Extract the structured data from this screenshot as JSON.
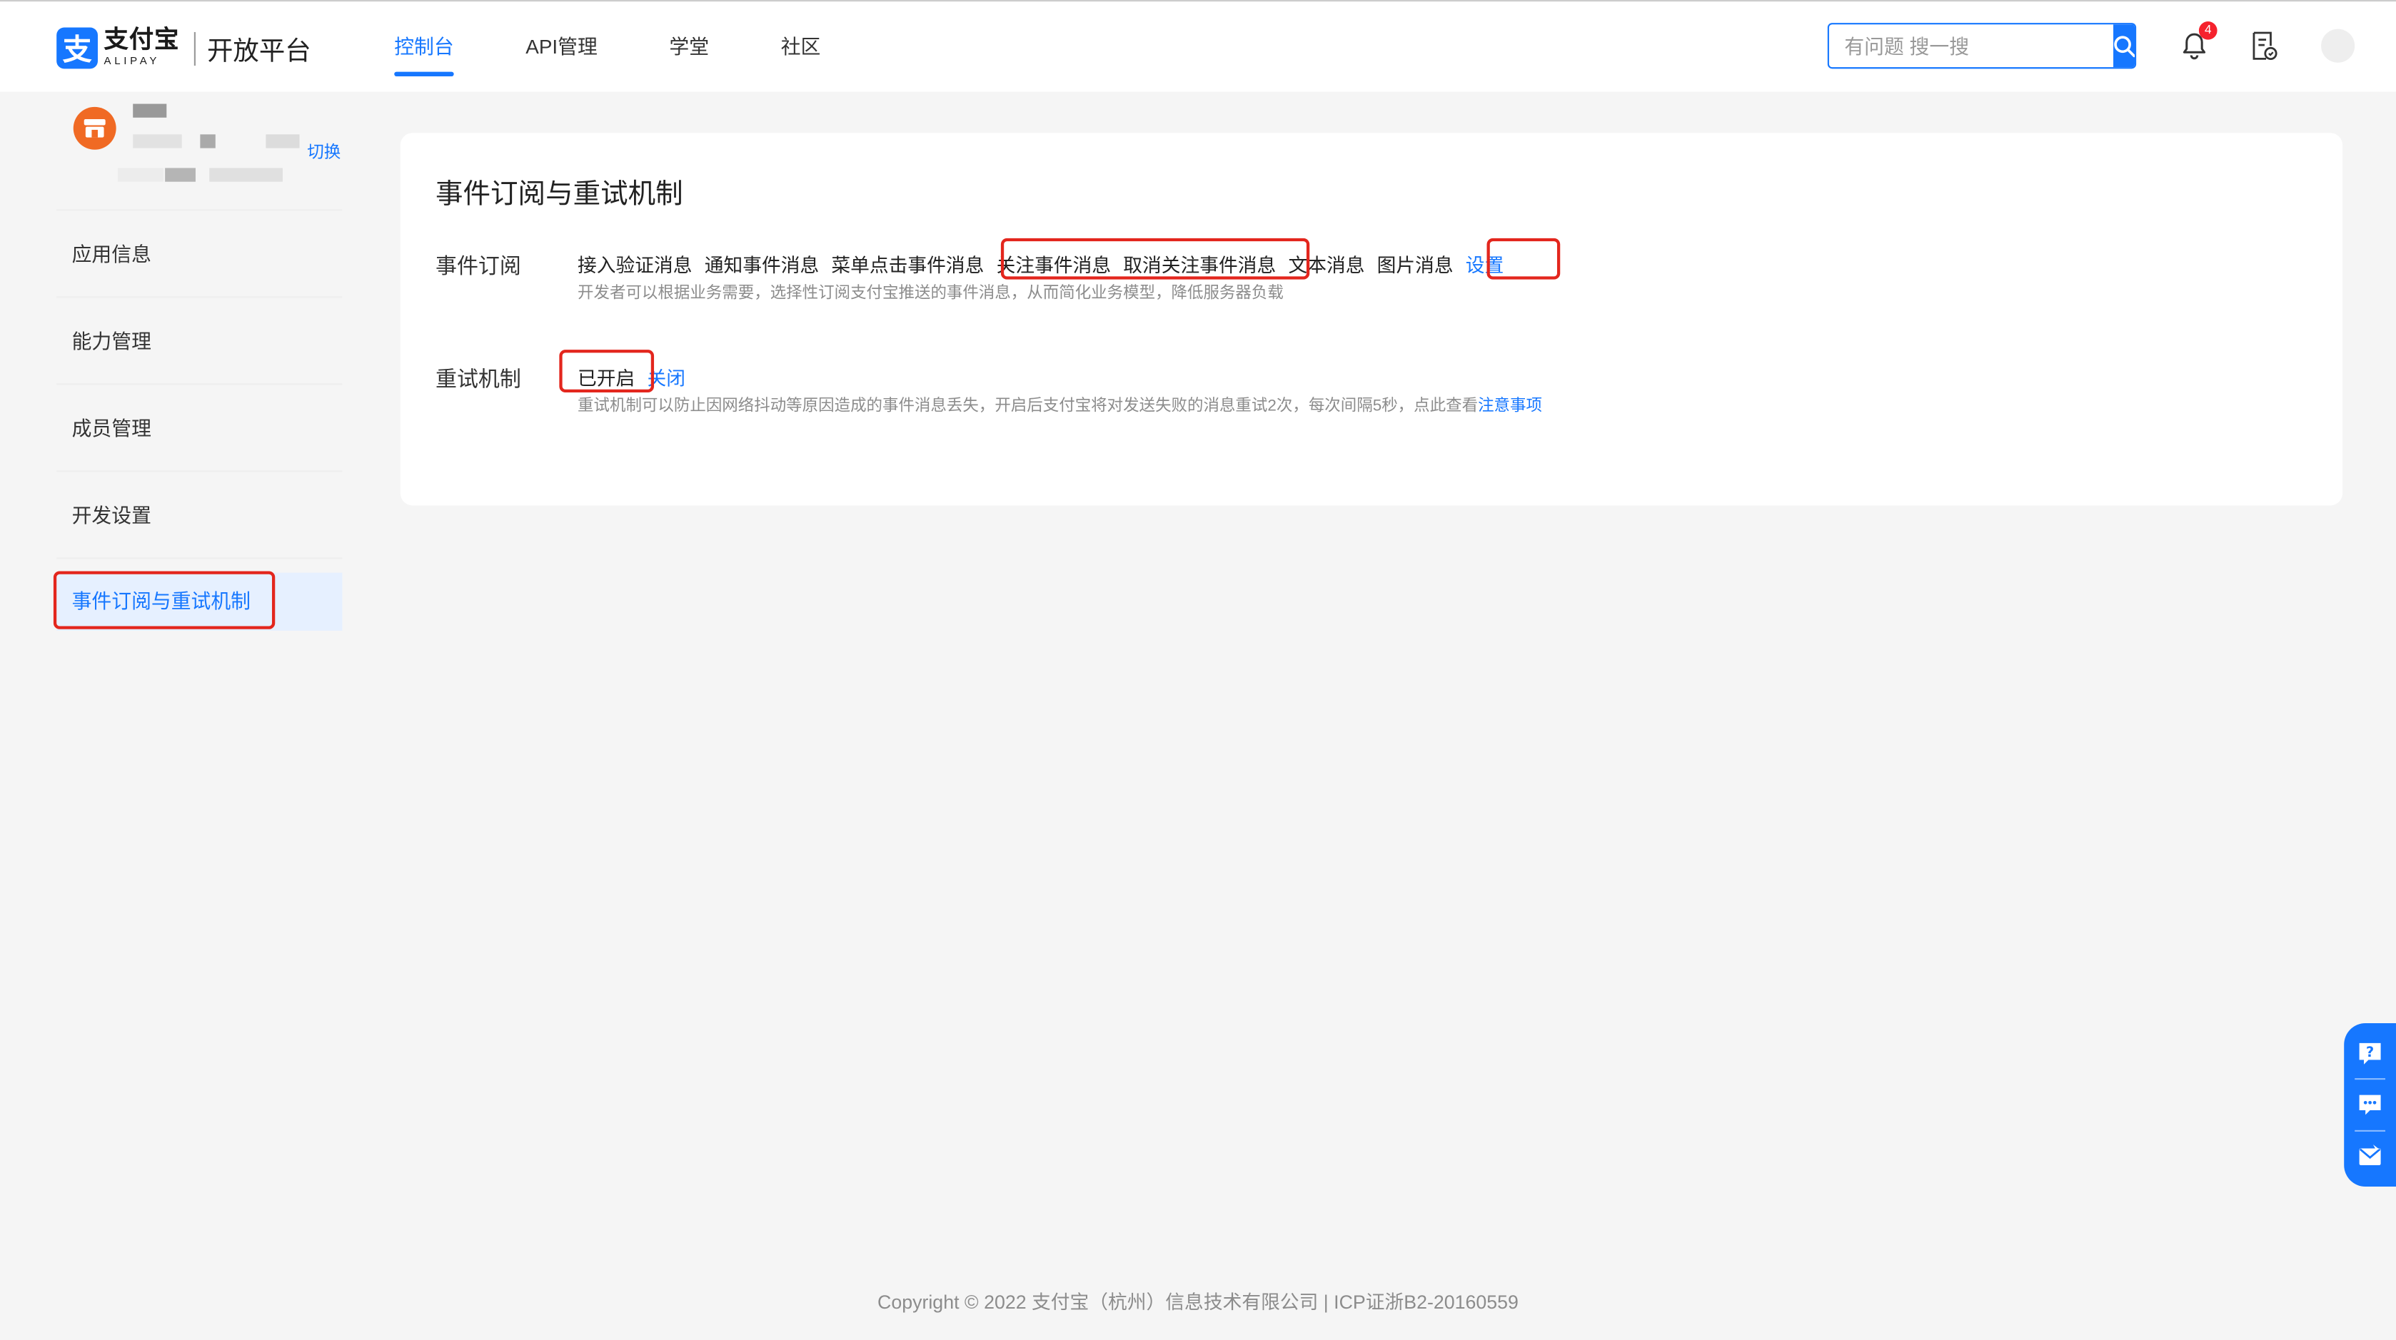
{
  "header": {
    "logo_cn": "支付宝",
    "logo_en": "ALIPAY",
    "logo_glyph": "支",
    "platform": "开放平台",
    "nav": [
      {
        "label": "控制台",
        "active": true
      },
      {
        "label": "API管理",
        "active": false
      },
      {
        "label": "学堂",
        "active": false
      },
      {
        "label": "社区",
        "active": false
      }
    ],
    "search_placeholder": "有问题 搜一搜",
    "notification_count": "4",
    "icons": {
      "search": "search-icon",
      "bell": "bell-icon",
      "document": "document-icon",
      "avatar": "avatar"
    },
    "accent_color": "#1677ff"
  },
  "sidebar": {
    "switch_label": "切换",
    "menu": [
      {
        "label": "应用信息",
        "active": false
      },
      {
        "label": "能力管理",
        "active": false
      },
      {
        "label": "成员管理",
        "active": false
      },
      {
        "label": "开发设置",
        "active": false
      },
      {
        "label": "事件订阅与重试机制",
        "active": true
      }
    ]
  },
  "main": {
    "title": "事件订阅与重试机制",
    "subscription": {
      "label": "事件订阅",
      "events": [
        "接入验证消息",
        "通知事件消息",
        "菜单点击事件消息",
        "关注事件消息",
        "取消关注事件消息",
        "文本消息",
        "图片消息"
      ],
      "settings_link": "设置",
      "hint": "开发者可以根据业务需要，选择性订阅支付宝推送的事件消息，从而简化业务模型，降低服务器负载"
    },
    "retry": {
      "label": "重试机制",
      "status": "已开启",
      "toggle_link": "关闭",
      "hint": "重试机制可以防止因网络抖动等原因造成的事件消息丢失，开启后支付宝将对发送失败的消息重试2次，每次间隔5秒，点此查看",
      "hint_link": "注意事项"
    }
  },
  "footer": {
    "text": "Copyright © 2022 支付宝（杭州）信息技术有限公司 | ICP证浙B2-20160559"
  },
  "float_panel": {
    "icons": [
      "help-icon",
      "chat-icon",
      "feedback-icon"
    ]
  },
  "highlight_color": "#e3261d"
}
